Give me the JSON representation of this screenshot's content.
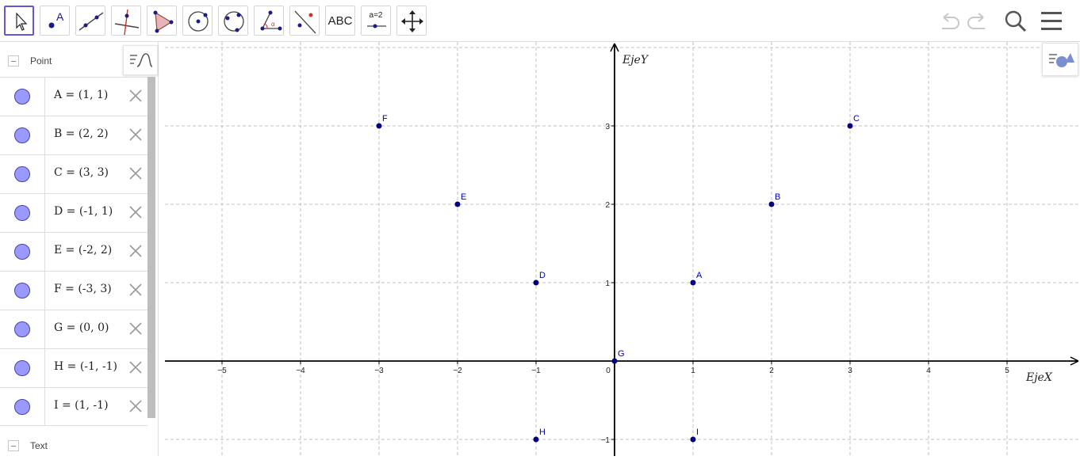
{
  "toolbar": {
    "tools": [
      {
        "name": "move-tool",
        "selected": true
      },
      {
        "name": "point-tool"
      },
      {
        "name": "line-tool"
      },
      {
        "name": "perpendicular-line-tool"
      },
      {
        "name": "polygon-tool"
      },
      {
        "name": "circle-center-point-tool"
      },
      {
        "name": "circle-three-points-tool"
      },
      {
        "name": "angle-tool"
      },
      {
        "name": "reflect-tool"
      },
      {
        "name": "text-tool",
        "label": "ABC"
      },
      {
        "name": "slider-tool",
        "label": "a=2"
      },
      {
        "name": "move-graphics-view-tool"
      }
    ]
  },
  "algebra": {
    "sections": {
      "point_header": "Point",
      "text_header": "Text"
    },
    "items": [
      {
        "expr": "A = (1, 1)"
      },
      {
        "expr": "B = (2, 2)"
      },
      {
        "expr": "C = (3, 3)"
      },
      {
        "expr": "D = (-1, 1)"
      },
      {
        "expr": "E = (-2, 2)"
      },
      {
        "expr": "F = (-3, 3)"
      },
      {
        "expr": "G = (0, 0)"
      },
      {
        "expr": "H = (-1, -1)"
      },
      {
        "expr": "I = (1, -1)"
      }
    ]
  },
  "graphics": {
    "x_axis_label": "EjeX",
    "y_axis_label": "EjeY",
    "x_ticks": [
      -5,
      -4,
      -3,
      -2,
      -1,
      0,
      1,
      2,
      3,
      4,
      5
    ],
    "y_ticks": [
      3,
      2,
      1,
      -1
    ],
    "points": [
      {
        "label": "A",
        "x": 1,
        "y": 1
      },
      {
        "label": "B",
        "x": 2,
        "y": 2
      },
      {
        "label": "C",
        "x": 3,
        "y": 3
      },
      {
        "label": "D",
        "x": -1,
        "y": 1
      },
      {
        "label": "E",
        "x": -2,
        "y": 2
      },
      {
        "label": "F",
        "x": -3,
        "y": 3
      },
      {
        "label": "G",
        "x": 0,
        "y": 0
      },
      {
        "label": "H",
        "x": -1,
        "y": -1
      },
      {
        "label": "I",
        "x": 1,
        "y": -1
      }
    ],
    "point_color": "#00007f",
    "axis_color": "#000000",
    "grid_color": "#c0c0c0"
  }
}
